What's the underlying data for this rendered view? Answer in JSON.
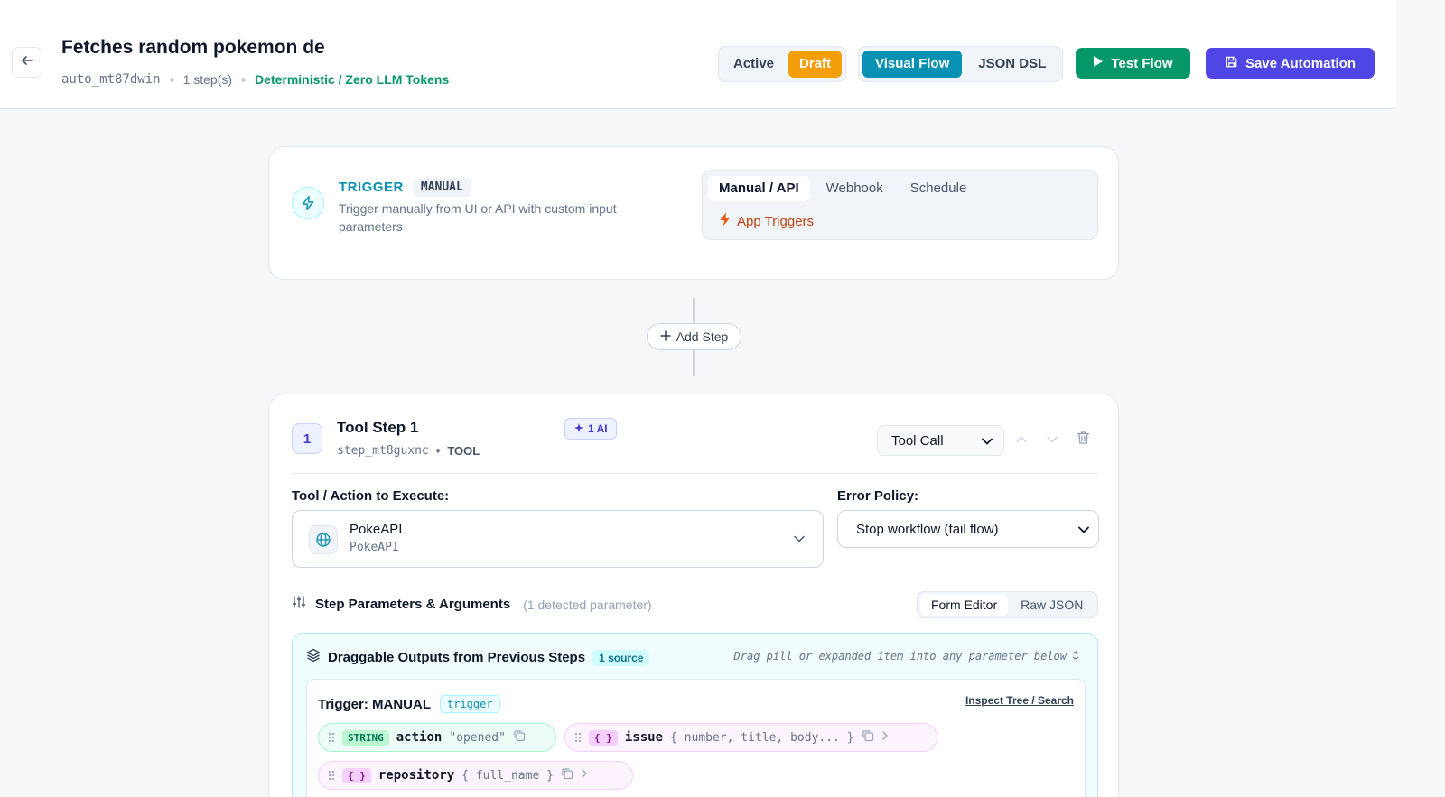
{
  "header": {
    "title": "Fetches random pokemon de",
    "automation_id": "auto_mt87dwin",
    "steps_count": "1 step(s)",
    "mode_note": "Deterministic / Zero LLM Tokens",
    "status_options": [
      "Active",
      "Draft"
    ],
    "status_selected": "Draft",
    "view_modes": [
      "Visual Flow",
      "JSON DSL"
    ],
    "view_selected": "Visual Flow",
    "test_label": "Test Flow",
    "save_label": "Save Automation"
  },
  "trigger": {
    "label": "TRIGGER",
    "badge": "MANUAL",
    "description": "Trigger manually from UI or API with custom input parameters",
    "types": [
      "Manual / API",
      "Webhook",
      "Schedule"
    ],
    "type_selected": "Manual / API",
    "app_triggers": "App Triggers"
  },
  "connector": {
    "add_step": "Add Step"
  },
  "step": {
    "number": "1",
    "title": "Tool Step 1",
    "id": "step_mt8guxnc",
    "kind": "TOOL",
    "ai_badge": "1 AI",
    "type_value": "Tool Call",
    "tool_label": "Tool / Action to Execute:",
    "tool_name": "PokeAPI",
    "tool_sub": "PokeAPI",
    "error_label": "Error Policy:",
    "error_value": "Stop workflow (fail flow)",
    "params_title": "Step Parameters & Arguments",
    "params_count": "(1 detected parameter)",
    "editor_modes": [
      "Form Editor",
      "Raw JSON"
    ],
    "editor_selected": "Form Editor"
  },
  "outputs": {
    "title": "Draggable Outputs from Previous Steps",
    "source_badge": "1 source",
    "hint": "Drag pill or expanded item into any parameter below",
    "source_title": "Trigger: MANUAL",
    "source_tag": "trigger",
    "inspect": "Inspect Tree / Search",
    "pills": [
      {
        "type": "STRING",
        "name": "action",
        "value": "\"opened\""
      },
      {
        "type": "{ }",
        "name": "issue",
        "value": "{ number, title, body... }"
      },
      {
        "type": "{ }",
        "name": "repository",
        "value": "{ full_name }"
      }
    ]
  },
  "colors": {
    "accent_cyan": "#0891b2",
    "draft_orange": "#f59e0b",
    "test_green": "#059669",
    "save_indigo": "#4f46e5"
  }
}
